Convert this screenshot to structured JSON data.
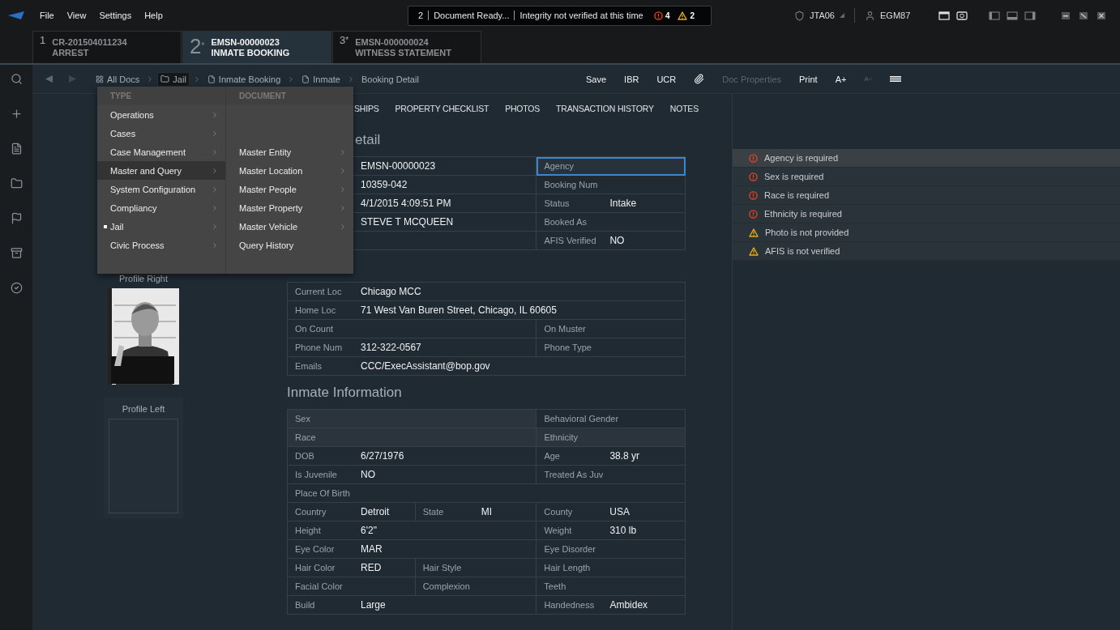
{
  "menu_bar": [
    "File",
    "View",
    "Settings",
    "Help"
  ],
  "status": {
    "count": "2",
    "title": "Document Ready...",
    "message": "Integrity not verified at this time",
    "errors": "4",
    "warnings": "2"
  },
  "users": {
    "agency": "JTA06",
    "user": "EGM87"
  },
  "doc_tabs": [
    {
      "number": "1",
      "id": "CR-201504011234",
      "title": "ARREST",
      "selected": false
    },
    {
      "number": "2",
      "marker": "*",
      "id": "EMSN-00000023",
      "title": "INMATE BOOKING",
      "selected": true
    },
    {
      "number": "3",
      "marker": "*",
      "id": "EMSN-000000024",
      "title": "WITNESS STATEMENT",
      "selected": false
    }
  ],
  "breadcrumb": [
    {
      "label": "All Docs",
      "kind": "grid",
      "selected": false
    },
    {
      "label": "Jail",
      "kind": "folder",
      "selected": true
    },
    {
      "label": "Inmate Booking",
      "kind": "file",
      "selected": false
    },
    {
      "label": "Inmate",
      "kind": "file",
      "selected": false
    },
    {
      "label": "Booking Detail",
      "kind": "none",
      "selected": false
    }
  ],
  "actions": [
    {
      "label": "Save",
      "kind": "text",
      "disabled": false
    },
    {
      "label": "IBR",
      "kind": "text",
      "disabled": false
    },
    {
      "label": "UCR",
      "kind": "text",
      "disabled": false
    },
    {
      "kind": "attach",
      "disabled": false
    },
    {
      "label": "Doc Properties",
      "kind": "text",
      "disabled": true
    },
    {
      "label": "Print",
      "kind": "text",
      "disabled": false
    },
    {
      "label": "A+",
      "kind": "text",
      "disabled": false
    },
    {
      "label": "A−",
      "kind": "small",
      "disabled": true
    },
    {
      "kind": "columns",
      "disabled": false
    }
  ],
  "dropdown": {
    "type_header": "TYPE",
    "document_header": "DOCUMENT",
    "types": [
      {
        "label": "Operations",
        "selected": false,
        "current": false
      },
      {
        "label": "Cases",
        "selected": false,
        "current": false
      },
      {
        "label": "Case Management",
        "selected": false,
        "current": false
      },
      {
        "label": "Master and Query",
        "selected": true,
        "current": false
      },
      {
        "label": "System Configuration",
        "selected": false,
        "current": false
      },
      {
        "label": "Compliancy",
        "selected": false,
        "current": false
      },
      {
        "label": "Jail",
        "selected": false,
        "current": true
      },
      {
        "label": "Civic Process",
        "selected": false,
        "current": false
      }
    ],
    "documents": [
      {
        "label": "Master Entity",
        "submenu": true
      },
      {
        "label": "Master Location",
        "submenu": true
      },
      {
        "label": "Master People",
        "submenu": true
      },
      {
        "label": "Master Property",
        "submenu": true
      },
      {
        "label": "Master Vehicle",
        "submenu": true
      },
      {
        "label": "Query History",
        "submenu": false
      }
    ]
  },
  "section_tabs": [
    "SHIPS",
    "PROPERTY CHECKLIST",
    "PHOTOS",
    "TRANSACTION HISTORY",
    "NOTES"
  ],
  "photos": [
    {
      "label": "Profile Right",
      "kind": "picture"
    },
    {
      "label": "Profile Left",
      "kind": "empty"
    }
  ],
  "booking_title": "etail",
  "booking_rows": [
    [
      {
        "kind": "left",
        "value": "EMSN-00000023"
      },
      {
        "kind": "right",
        "label": "Agency",
        "focused": true
      }
    ],
    [
      {
        "kind": "left",
        "value": "10359-042"
      },
      {
        "kind": "right",
        "label": "Booking Num"
      }
    ],
    [
      {
        "kind": "left",
        "value": "4/1/2015 4:09:51 PM"
      },
      {
        "kind": "right",
        "label": "Status",
        "value": "Intake"
      }
    ],
    [
      {
        "kind": "left",
        "value": "STEVE T MCQUEEN"
      },
      {
        "kind": "right",
        "label": "Booked As"
      }
    ],
    [
      {
        "kind": "left"
      },
      {
        "kind": "right",
        "label": "AFIS Verified",
        "value": "NO"
      }
    ]
  ],
  "contact_rows": [
    [
      {
        "kind": "full",
        "label": "Current Loc",
        "value": "Chicago MCC"
      }
    ],
    [
      {
        "kind": "full",
        "label": "Home Loc",
        "value": "71 West Van Buren Street, Chicago, IL 60605"
      }
    ],
    [
      {
        "kind": "left",
        "label": "On Count"
      },
      {
        "kind": "right",
        "label": "On Muster"
      }
    ],
    [
      {
        "kind": "left",
        "label": "Phone Num",
        "value": "312-322-0567"
      },
      {
        "kind": "right",
        "label": "Phone Type"
      }
    ],
    [
      {
        "kind": "full",
        "label": "Emails",
        "value": "CCC/ExecAssistant@bop.gov"
      }
    ]
  ],
  "inmate_title": "Inmate  Information",
  "inmate_rows": [
    [
      {
        "kind": "left",
        "label": "Sex",
        "highlighted": true
      },
      {
        "kind": "right",
        "label": "Behavioral Gender",
        "highlighted": false
      }
    ],
    [
      {
        "kind": "left",
        "label": "Race",
        "highlighted": true
      },
      {
        "kind": "right",
        "label": "Ethnicity",
        "highlighted": true
      }
    ],
    [
      {
        "kind": "left",
        "label": "DOB",
        "value": "6/27/1976"
      },
      {
        "kind": "right",
        "label": "Age",
        "value": "38.8 yr"
      }
    ],
    [
      {
        "kind": "left",
        "label": "Is Juvenile",
        "value": "NO"
      },
      {
        "kind": "right",
        "label": "Treated As Juv"
      }
    ],
    [
      {
        "kind": "full",
        "label": "Place Of Birth"
      }
    ],
    [
      {
        "kind": "q1",
        "label": "Country",
        "value": "Detroit"
      },
      {
        "kind": "q2",
        "label": "State",
        "value": "MI"
      },
      {
        "kind": "right",
        "label": "County",
        "value": "USA"
      }
    ],
    [
      {
        "kind": "left",
        "label": "Height",
        "value": "6'2\""
      },
      {
        "kind": "right",
        "label": "Weight",
        "value": "310 lb"
      }
    ],
    [
      {
        "kind": "left",
        "label": "Eye Color",
        "value": "MAR"
      },
      {
        "kind": "right",
        "label": "Eye Disorder"
      }
    ],
    [
      {
        "kind": "q1",
        "label": "Hair Color",
        "value": "RED"
      },
      {
        "kind": "q2",
        "label": "Hair Style"
      },
      {
        "kind": "right",
        "label": "Hair Length"
      }
    ],
    [
      {
        "kind": "q1",
        "label": "Facial Color"
      },
      {
        "kind": "q2",
        "label": "Complexion"
      },
      {
        "kind": "right",
        "label": "Teeth"
      }
    ],
    [
      {
        "kind": "left",
        "label": "Build",
        "value": "Large"
      },
      {
        "kind": "right",
        "label": "Handedness",
        "value": "Ambidex"
      }
    ]
  ],
  "validation": [
    {
      "kind": "error",
      "text": "Agency is required",
      "selected": true
    },
    {
      "kind": "error",
      "text": "Sex is required",
      "selected": false
    },
    {
      "kind": "error",
      "text": "Race is required",
      "selected": false
    },
    {
      "kind": "error",
      "text": "Ethnicity is required",
      "selected": false
    },
    {
      "kind": "warning",
      "text": "Photo is not provided",
      "selected": false
    },
    {
      "kind": "warning",
      "text": "AFIS is not verified",
      "selected": false
    }
  ]
}
